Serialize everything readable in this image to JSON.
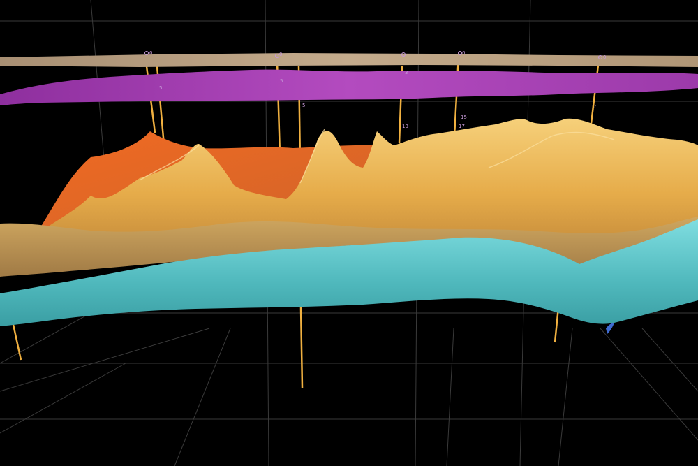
{
  "colors": {
    "background": "#000000",
    "grid": "#3a3a3a",
    "top_layer": "#b29a7c",
    "purple_layer": "#a13fb0",
    "orange_layer": "#e3702a",
    "yellow_layer": "#e8b351",
    "tan_layer": "#c79c55",
    "cyan_layer": "#5cc6c9",
    "wells": "#f0b040",
    "label": "#c79ad8"
  },
  "well_labels": {
    "w1_top": "0",
    "w1_purple": "5",
    "w2_top": "0",
    "w2_purple": "5",
    "w2_mid": "5",
    "w3_purple": "3",
    "w3_mid": "13",
    "w4_top": "0",
    "w4_mid_a": "15",
    "w4_mid_b": "17",
    "w5_top": "0",
    "w5_purple": "7"
  }
}
